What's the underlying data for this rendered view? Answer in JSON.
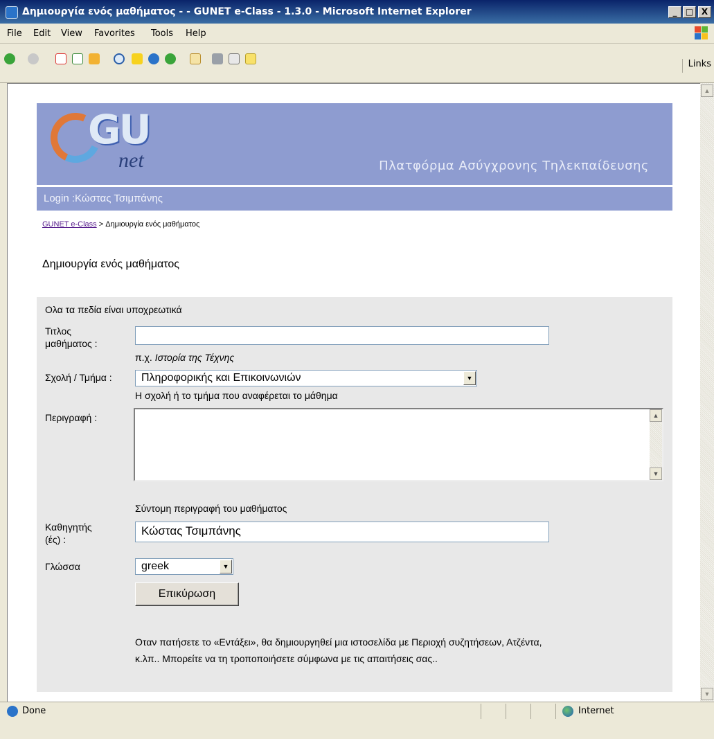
{
  "window": {
    "title": "Δημιουργία ενός μαθήματος - - GUNET e-Class - 1.3.0 - Microsoft Internet Explorer",
    "minimize": "_",
    "maximize": "□",
    "close": "X"
  },
  "menu": [
    "File",
    "Edit",
    "View",
    "Favorites",
    "Tools",
    "Help"
  ],
  "toolbar": {
    "links_label": "Links"
  },
  "header": {
    "logo_gu": "GU",
    "logo_net": "net",
    "platform_title": "Πλατφόρμα Ασύγχρονης Τηλεκπαίδευσης",
    "login_text": "Login :Κώστας Τσιμπάνης"
  },
  "breadcrumb": {
    "home_link": "GUNET e-Class",
    "separator": ">",
    "current": "Δημιουργία ενός μαθήματος"
  },
  "page": {
    "title": "Δημιουργία ενός μαθήματος"
  },
  "form": {
    "heading": "Ολα τα πεδία είναι υποχρεωτικά",
    "course_title_label_1": "Τιτλος",
    "course_title_label_2": "μαθήματος :",
    "course_title_value": "",
    "course_title_hint_prefix": "π.χ.",
    "course_title_hint_example": "Ιστορία της Τέχνης",
    "department_label": "Σχολή / Τμήμα :",
    "department_value": "Πληροφορικής και Επικοινωνιών",
    "department_hint": "Η σχολή ή το τμήμα που αναφέρεται το μάθημα",
    "description_label": "Περιγραφή :",
    "description_hint": "Σύντομη περιγραφή του μαθήματος",
    "professor_label_1": "Καθηγητής",
    "professor_label_2": "(ές) :",
    "professor_value": "Κώστας Τσιμπάνης",
    "language_label": "Γλώσσα",
    "language_value": "greek",
    "submit_label": "Επικύρωση",
    "footer_note_1": "Οταν πατήσετε το «Εντάξει», θα δημιουργηθεί μια ιστοσελίδα με Περιοχή συζητήσεων, Ατζέντα,",
    "footer_note_2": "κ.λπ.. Μπορείτε να τη τροποποιήσετε σύμφωνα με τις απαιτήσεις σας.."
  },
  "status": {
    "text": "Done",
    "zone": "Internet"
  },
  "colors": {
    "header_bg": "#8e9cd0",
    "panel_bg": "#e8e8e8",
    "link": "#551a8b"
  }
}
